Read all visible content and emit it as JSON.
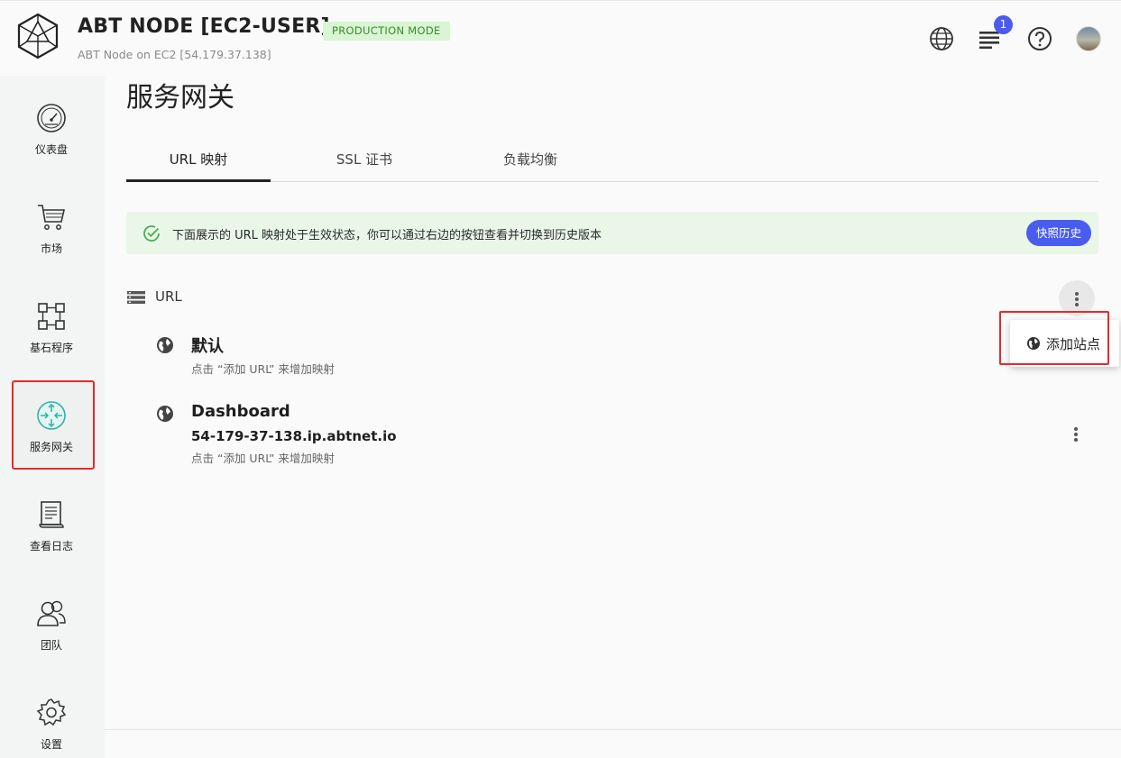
{
  "header": {
    "title": "ABT NODE [EC2-USER]",
    "mode_badge": "PRODUCTION MODE",
    "subtitle": "ABT Node on EC2 [54.179.37.138]",
    "notification_count": "1",
    "icons": [
      "language-globe-icon",
      "notifications-list-icon",
      "help-icon",
      "user-avatar"
    ]
  },
  "sidebar": {
    "items": [
      {
        "label": "仪表盘",
        "icon": "dashboard-gauge-icon"
      },
      {
        "label": "市场",
        "icon": "cart-icon"
      },
      {
        "label": "基石程序",
        "icon": "blocklet-nodes-icon"
      },
      {
        "label": "服务网关",
        "icon": "gateway-icon",
        "active": true
      },
      {
        "label": "查看日志",
        "icon": "log-icon"
      },
      {
        "label": "团队",
        "icon": "team-icon"
      },
      {
        "label": "设置",
        "icon": "settings-gear-icon"
      }
    ]
  },
  "main": {
    "page_title": "服务网关",
    "tabs": [
      {
        "label": "URL 映射",
        "active": true
      },
      {
        "label": "SSL 证书"
      },
      {
        "label": "负载均衡"
      }
    ],
    "alert": {
      "text": "下面展示的 URL 映射处于生效状态，你可以通过右边的按钮查看并切换到历史版本",
      "button_label": "快照历史"
    },
    "section_label": "URL",
    "sites": [
      {
        "name": "默认",
        "domain": "",
        "hint": "点击 “添加 URL” 来增加映射"
      },
      {
        "name": "Dashboard",
        "domain": "54-179-37-138.ip.abtnet.io",
        "hint": "点击 “添加 URL” 来增加映射"
      }
    ]
  },
  "menu": {
    "items": [
      {
        "label": "添加站点",
        "icon": "globe-icon"
      }
    ]
  },
  "colors": {
    "accent": "#4a5cf0",
    "highlight": "#e8292b",
    "badge_bg": "#d9f5d3",
    "alert_bg": "#e9f6e8",
    "gateway_icon": "#2fb3a6"
  }
}
